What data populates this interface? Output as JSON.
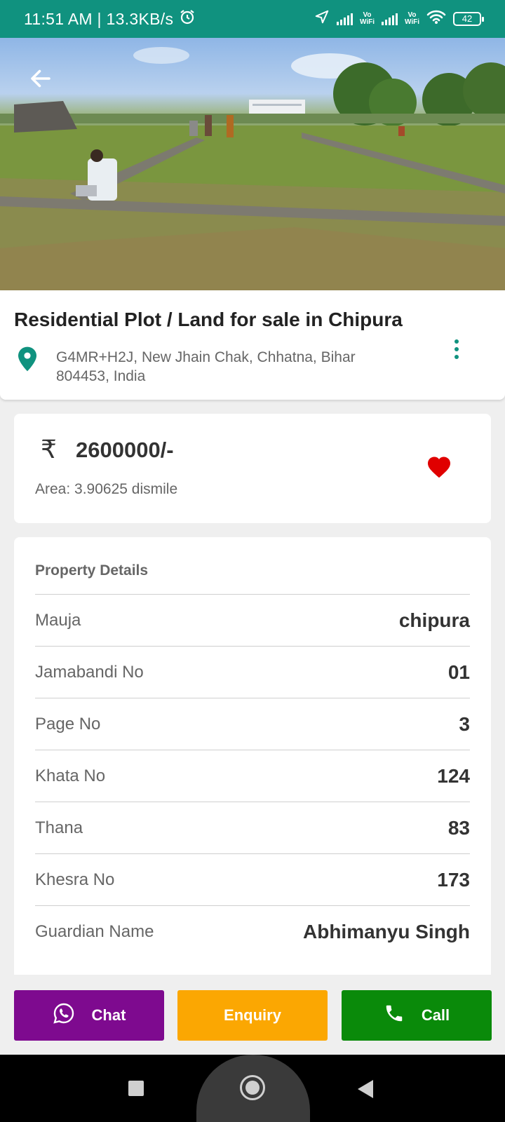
{
  "status_bar": {
    "time_speed": "11:51 AM | 13.3KB/s",
    "volte1": "Vo\nWiFi",
    "volte2": "Vo\nWiFi",
    "battery": "42"
  },
  "listing": {
    "title": "Residential Plot / Land for sale in Chipura",
    "address": "G4MR+H2J, New Jhain Chak, Chhatna, Bihar 804453, India"
  },
  "price": {
    "currency_symbol": "₹",
    "amount": "2600000/-",
    "area": "Area: 3.90625 dismile"
  },
  "details": {
    "title": "Property Details",
    "rows": [
      {
        "label": "Mauja",
        "value": "chipura"
      },
      {
        "label": "Jamabandi No",
        "value": "01"
      },
      {
        "label": "Page No",
        "value": "3"
      },
      {
        "label": "Khata No",
        "value": "124"
      },
      {
        "label": "Thana",
        "value": "83"
      },
      {
        "label": "Khesra No",
        "value": "173"
      },
      {
        "label": "Guardian Name",
        "value": "Abhimanyu Singh"
      }
    ]
  },
  "actions": {
    "chat_label": "Chat",
    "enquiry_label": "Enquiry",
    "call_label": "Call"
  },
  "colors": {
    "accent": "#10927f",
    "chat": "#7e0a8f",
    "enquiry": "#fba702",
    "call": "#0a8a0a",
    "favorite": "#e00000"
  },
  "icons": {
    "back": "arrow-left-icon",
    "location": "location-pin-icon",
    "more": "more-vertical-icon",
    "favorite": "heart-icon",
    "whatsapp": "whatsapp-icon",
    "phone": "phone-icon"
  }
}
